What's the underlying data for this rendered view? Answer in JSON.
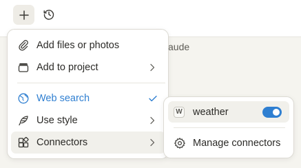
{
  "toolbar": {
    "add_icon": "plus-icon",
    "history_icon": "clock-history-icon"
  },
  "background": {
    "partial_text": "aude"
  },
  "menu": {
    "items": [
      {
        "label": "Add files or photos",
        "icon": "paperclip-icon"
      },
      {
        "label": "Add to project",
        "icon": "project-box-icon",
        "has_submenu": true
      },
      {
        "label": "Web search",
        "icon": "globe-icon",
        "checked": true
      },
      {
        "label": "Use style",
        "icon": "feather-pen-icon",
        "has_submenu": true
      },
      {
        "label": "Connectors",
        "icon": "connectors-grid-icon",
        "has_submenu": true
      }
    ]
  },
  "connectors_submenu": {
    "items": [
      {
        "badge": "W",
        "label": "weather",
        "enabled": true
      },
      {
        "label": "Manage connectors",
        "icon": "gear-icon"
      }
    ]
  },
  "colors": {
    "accent": "#2f7fd1",
    "background": "#f5f4ef",
    "hover": "#f1f0eb"
  }
}
